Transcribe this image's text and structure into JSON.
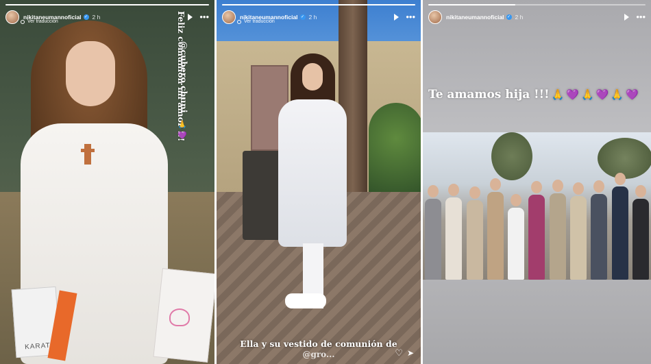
{
  "stories": [
    {
      "username": "nikitaneumannoficial",
      "time": "2 h",
      "translate_label": "Ver traducción",
      "progress": 1,
      "caption_line1": "Feliz comunión mi amor !!!",
      "caption_line2": "@cubero.chuni",
      "emojis": [
        "🙏",
        "💜"
      ],
      "bag_brand": "KARAT"
    },
    {
      "username": "nikitaneumannoficial",
      "time": "2 h",
      "translate_label": "Ver traducción",
      "progress": 1,
      "caption_line1": "Ella y su vestido de comunión de",
      "caption_line2": "@gro..."
    },
    {
      "username": "nikitaneumannoficial",
      "time": "2 h",
      "progress": 0.4,
      "caption": "Te amamos hija !!!",
      "emojis": [
        "🙏",
        "💜",
        "🙏",
        "💜",
        "🙏",
        "💜"
      ]
    }
  ],
  "icons": {
    "play": "play-icon",
    "more": "more-options-icon",
    "verified": "verified-badge-icon",
    "heart": "heart-icon",
    "send": "send-icon"
  },
  "colors": {
    "verified": "#3897f0",
    "heart_emoji": "#9b3de6",
    "pray_emoji": "#f3c35a"
  }
}
